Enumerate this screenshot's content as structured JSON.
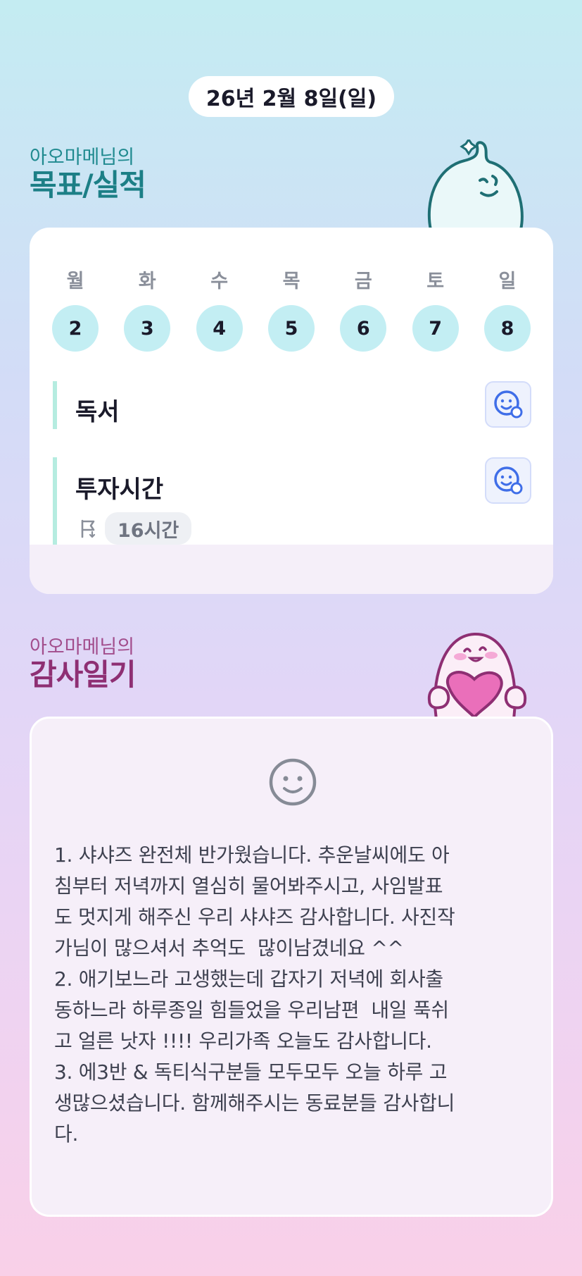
{
  "date_label": "26년 2월 8일(일)",
  "goals": {
    "owner": "아오마메님의",
    "title": "목표/실적",
    "week": [
      {
        "day": "월",
        "date": "2"
      },
      {
        "day": "화",
        "date": "3"
      },
      {
        "day": "수",
        "date": "4"
      },
      {
        "day": "목",
        "date": "5"
      },
      {
        "day": "금",
        "date": "6"
      },
      {
        "day": "토",
        "date": "7"
      },
      {
        "day": "일",
        "date": "8"
      }
    ],
    "items": [
      {
        "name": "독서",
        "icon": "smile-status-icon"
      },
      {
        "name": "투자시간",
        "icon": "smile-status-icon",
        "target": "16시간",
        "target_icon": "flag-icon"
      }
    ]
  },
  "thanks": {
    "owner": "아오마메님의",
    "title": "감사일기",
    "mood_icon": "smile-face-icon",
    "entry": "1. 샤샤즈 완전체 반가웠습니다. 추운날씨에도 아\n침부터 저녁까지 열심히 물어봐주시고, 사임발표\n도 멋지게 해주신 우리 샤샤즈 감사합니다. 사진작\n가님이 많으셔서 추억도  많이남겼네요 ^^\n2. 애기보느라 고생했는데 갑자기 저녁에 회사출\n동하느라 하루종일 힘들었을 우리남편  내일 푹쉬\n고 얼른 낫자 !!!! 우리가족 오늘도 감사합니다.\n3. 에3반 & 독티식구분들 모두모두 오늘 하루 고\n생많으셨습니다. 함께해주시는 동료분들 감사합니\n다."
  },
  "colors": {
    "goal_accent": "#1c7f86",
    "thanks_accent": "#8e2f73",
    "date_circle": "#c3eef3",
    "goal_bar": "#b5ece0",
    "icon_blue": "#3f6ee8"
  }
}
